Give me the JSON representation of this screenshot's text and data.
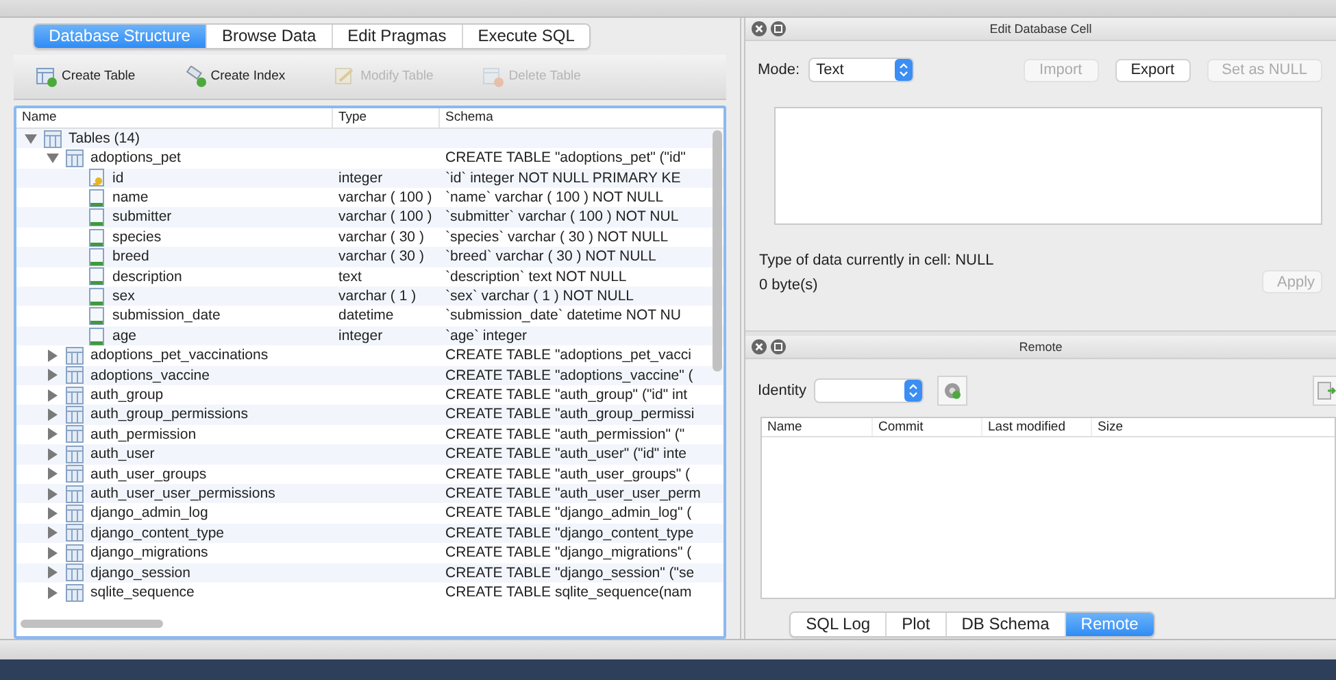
{
  "main_tabs": [
    {
      "label": "Database Structure",
      "selected": true
    },
    {
      "label": "Browse Data",
      "selected": false
    },
    {
      "label": "Edit Pragmas",
      "selected": false
    },
    {
      "label": "Execute SQL",
      "selected": false
    }
  ],
  "toolbar": [
    {
      "label": "Create Table",
      "kind": "create_table",
      "disabled": false
    },
    {
      "label": "Create Index",
      "kind": "create_index",
      "disabled": false
    },
    {
      "label": "Modify Table",
      "kind": "modify_table",
      "disabled": true
    },
    {
      "label": "Delete Table",
      "kind": "delete_table",
      "disabled": true
    }
  ],
  "structure": {
    "columns": [
      "Name",
      "Type",
      "Schema"
    ],
    "tree": [
      {
        "name": "Tables (14)",
        "kind": "group",
        "expanded": true,
        "children": [
          {
            "name": "adoptions_pet",
            "kind": "table",
            "expanded": true,
            "schema": "CREATE TABLE \"adoptions_pet\" (\"id\"",
            "children": [
              {
                "name": "id",
                "kind": "key",
                "type": "integer",
                "schema": "`id` integer NOT NULL PRIMARY KE"
              },
              {
                "name": "name",
                "kind": "field",
                "type": "varchar ( 100 )",
                "schema": "`name` varchar ( 100 ) NOT NULL"
              },
              {
                "name": "submitter",
                "kind": "field",
                "type": "varchar ( 100 )",
                "schema": "`submitter` varchar ( 100 ) NOT NUL"
              },
              {
                "name": "species",
                "kind": "field",
                "type": "varchar ( 30 )",
                "schema": "`species` varchar ( 30 ) NOT NULL"
              },
              {
                "name": "breed",
                "kind": "field",
                "type": "varchar ( 30 )",
                "schema": "`breed` varchar ( 30 ) NOT NULL"
              },
              {
                "name": "description",
                "kind": "field",
                "type": "text",
                "schema": "`description` text NOT NULL"
              },
              {
                "name": "sex",
                "kind": "field",
                "type": "varchar ( 1 )",
                "schema": "`sex` varchar ( 1 ) NOT NULL"
              },
              {
                "name": "submission_date",
                "kind": "field",
                "type": "datetime",
                "schema": "`submission_date` datetime NOT NU"
              },
              {
                "name": "age",
                "kind": "field",
                "type": "integer",
                "schema": "`age` integer"
              }
            ]
          },
          {
            "name": "adoptions_pet_vaccinations",
            "kind": "table",
            "expanded": false,
            "schema": "CREATE TABLE \"adoptions_pet_vacci"
          },
          {
            "name": "adoptions_vaccine",
            "kind": "table",
            "expanded": false,
            "schema": "CREATE TABLE \"adoptions_vaccine\" ("
          },
          {
            "name": "auth_group",
            "kind": "table",
            "expanded": false,
            "schema": "CREATE TABLE \"auth_group\" (\"id\" int"
          },
          {
            "name": "auth_group_permissions",
            "kind": "table",
            "expanded": false,
            "schema": "CREATE TABLE \"auth_group_permissi"
          },
          {
            "name": "auth_permission",
            "kind": "table",
            "expanded": false,
            "schema": "CREATE TABLE \"auth_permission\" (\""
          },
          {
            "name": "auth_user",
            "kind": "table",
            "expanded": false,
            "schema": "CREATE TABLE \"auth_user\" (\"id\" inte"
          },
          {
            "name": "auth_user_groups",
            "kind": "table",
            "expanded": false,
            "schema": "CREATE TABLE \"auth_user_groups\" ("
          },
          {
            "name": "auth_user_user_permissions",
            "kind": "table",
            "expanded": false,
            "schema": "CREATE TABLE \"auth_user_user_perm"
          },
          {
            "name": "django_admin_log",
            "kind": "table",
            "expanded": false,
            "schema": "CREATE TABLE \"django_admin_log\" ("
          },
          {
            "name": "django_content_type",
            "kind": "table",
            "expanded": false,
            "schema": "CREATE TABLE \"django_content_type"
          },
          {
            "name": "django_migrations",
            "kind": "table",
            "expanded": false,
            "schema": "CREATE TABLE \"django_migrations\" ("
          },
          {
            "name": "django_session",
            "kind": "table",
            "expanded": false,
            "schema": "CREATE TABLE \"django_session\" (\"se"
          },
          {
            "name": "sqlite_sequence",
            "kind": "table",
            "expanded": false,
            "schema": "CREATE TABLE sqlite_sequence(nam"
          }
        ]
      }
    ]
  },
  "edit_cell": {
    "title": "Edit Database Cell",
    "mode_label": "Mode:",
    "mode_value": "Text",
    "buttons": [
      {
        "label": "Import",
        "disabled": true
      },
      {
        "label": "Export",
        "disabled": false
      },
      {
        "label": "Set as NULL",
        "disabled": true
      }
    ],
    "type_info": "Type of data currently in cell: NULL",
    "size_info": "0 byte(s)",
    "apply": {
      "label": "Apply",
      "disabled": true
    }
  },
  "remote": {
    "title": "Remote",
    "identity_label": "Identity",
    "columns": [
      "Name",
      "Commit",
      "Last modified",
      "Size"
    ]
  },
  "dock_tabs": [
    {
      "label": "SQL Log",
      "selected": false
    },
    {
      "label": "Plot",
      "selected": false
    },
    {
      "label": "DB Schema",
      "selected": false
    },
    {
      "label": "Remote",
      "selected": true
    }
  ]
}
